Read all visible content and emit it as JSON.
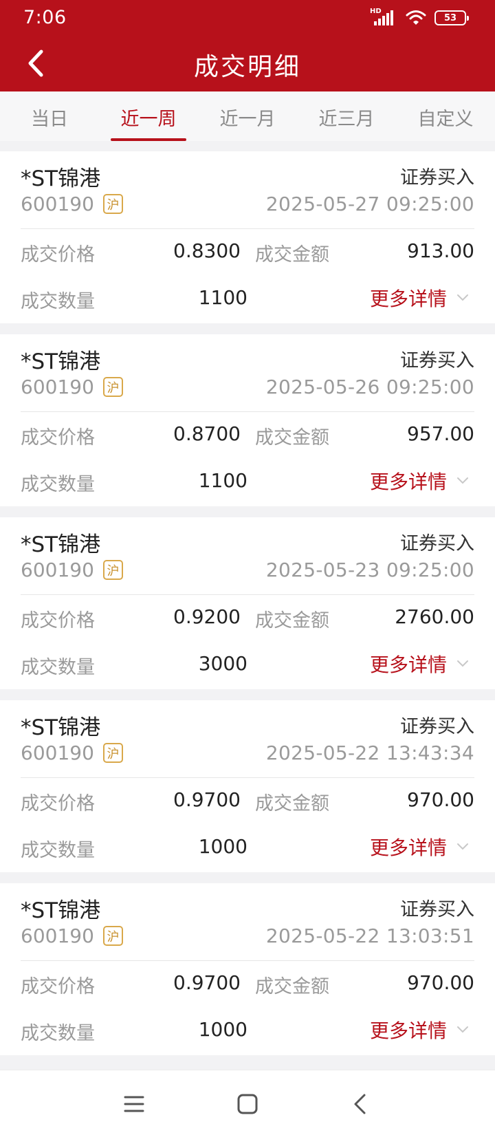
{
  "status_bar": {
    "time": "7:06",
    "network_label": "HD",
    "battery_level": "53"
  },
  "header": {
    "title": "成交明细",
    "background_color": "#b7111b"
  },
  "tabs": [
    {
      "label": "当日",
      "active": false
    },
    {
      "label": "近一周",
      "active": true
    },
    {
      "label": "近一月",
      "active": false
    },
    {
      "label": "近三月",
      "active": false
    },
    {
      "label": "自定义",
      "active": false
    }
  ],
  "labels": {
    "price": "成交价格",
    "amount": "成交金额",
    "quantity": "成交数量",
    "more": "更多详情"
  },
  "trades": [
    {
      "name": "*ST锦港",
      "code": "600190",
      "market": "沪",
      "type": "证券买入",
      "time": "2025-05-27 09:25:00",
      "price": "0.8300",
      "amount": "913.00",
      "quantity": "1100"
    },
    {
      "name": "*ST锦港",
      "code": "600190",
      "market": "沪",
      "type": "证券买入",
      "time": "2025-05-26 09:25:00",
      "price": "0.8700",
      "amount": "957.00",
      "quantity": "1100"
    },
    {
      "name": "*ST锦港",
      "code": "600190",
      "market": "沪",
      "type": "证券买入",
      "time": "2025-05-23 09:25:00",
      "price": "0.9200",
      "amount": "2760.00",
      "quantity": "3000"
    },
    {
      "name": "*ST锦港",
      "code": "600190",
      "market": "沪",
      "type": "证券买入",
      "time": "2025-05-22 13:43:34",
      "price": "0.9700",
      "amount": "970.00",
      "quantity": "1000"
    },
    {
      "name": "*ST锦港",
      "code": "600190",
      "market": "沪",
      "type": "证券买入",
      "time": "2025-05-22 13:03:51",
      "price": "0.9700",
      "amount": "970.00",
      "quantity": "1000"
    }
  ]
}
